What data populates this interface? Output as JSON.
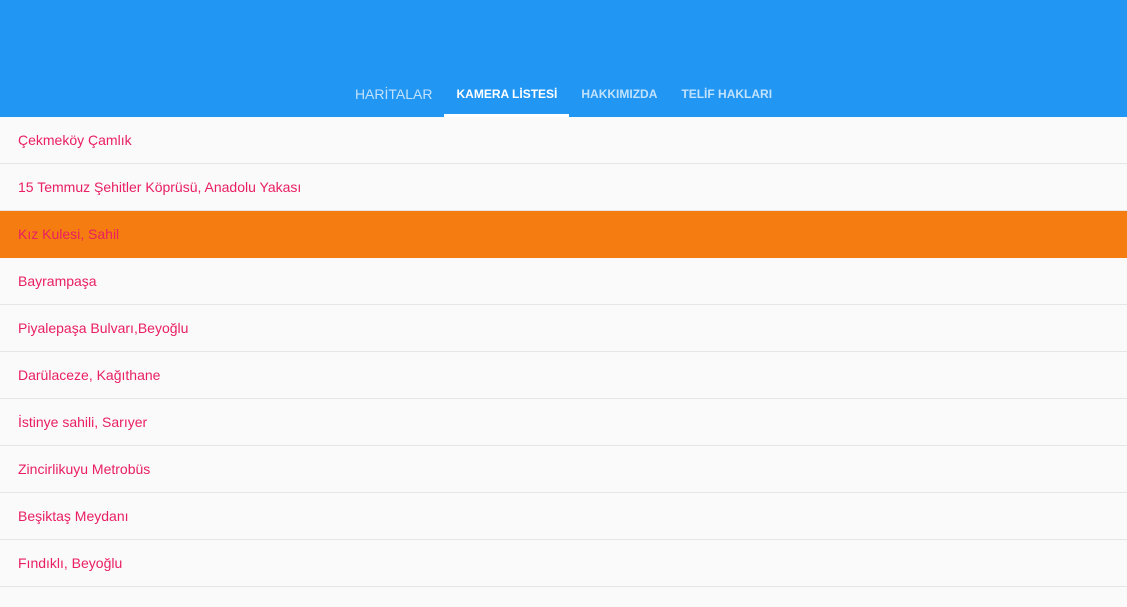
{
  "colors": {
    "app_bar": "#2196f3",
    "tab_indicator": "#ffffff",
    "item_text": "#e91e63",
    "selected_row": "#f57c10",
    "background": "#fafafa"
  },
  "tabs": [
    {
      "label": "HARİTALAR",
      "active": false
    },
    {
      "label": "KAMERA LİSTESİ",
      "active": true
    },
    {
      "label": "HAKKIMIZDA",
      "active": false
    },
    {
      "label": "TELİF HAKLARI",
      "active": false
    }
  ],
  "camera_list": {
    "selected_index": 2,
    "items": [
      "Çekmeköy Çamlık",
      "15 Temmuz Şehitler Köprüsü, Anadolu Yakası",
      "Kız Kulesi, Sahil",
      "Bayrampaşa",
      "Piyalepaşa Bulvarı,Beyoğlu",
      "Darülaceze, Kağıthane",
      "İstinye sahili, Sarıyer",
      "Zincirlikuyu Metrobüs",
      "Beşiktaş Meydanı",
      "Fındıklı, Beyoğlu",
      ""
    ]
  }
}
